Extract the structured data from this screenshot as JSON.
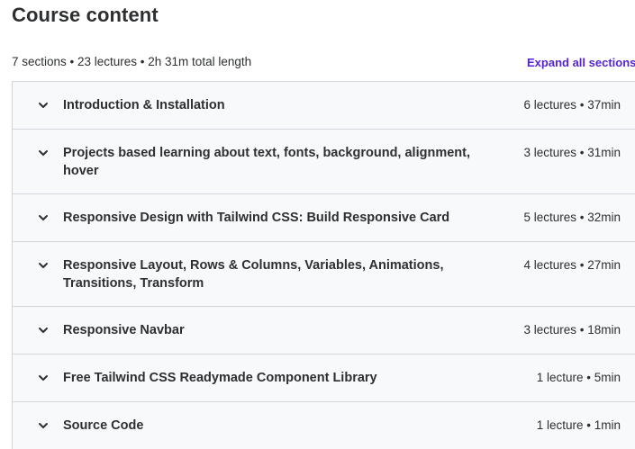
{
  "header": {
    "title": "Course content",
    "summary": "7 sections • 23 lectures • 2h 31m total length",
    "expand_label": "Expand all sections"
  },
  "sections": [
    {
      "title": "Introduction & Installation",
      "meta": "6 lectures • 37min"
    },
    {
      "title": "Projects based learning about text, fonts, background, alignment, hover",
      "meta": "3 lectures • 31min"
    },
    {
      "title": "Responsive Design with Tailwind CSS: Build Responsive Card",
      "meta": "5 lectures • 32min"
    },
    {
      "title": "Responsive Layout, Rows & Columns, Variables, Animations, Transitions, Transform",
      "meta": "4 lectures • 27min"
    },
    {
      "title": "Responsive Navbar",
      "meta": "3 lectures • 18min"
    },
    {
      "title": "Free Tailwind CSS Readymade Component Library",
      "meta": "1 lecture • 5min"
    },
    {
      "title": "Source Code",
      "meta": "1 lecture • 1min"
    }
  ],
  "colors": {
    "accent": "#5624d0",
    "section_bg": "#f7f9fa",
    "border": "#d1d7dc",
    "text": "#2d2f31"
  },
  "icons": {
    "section_toggle": "chevron-down-icon"
  }
}
